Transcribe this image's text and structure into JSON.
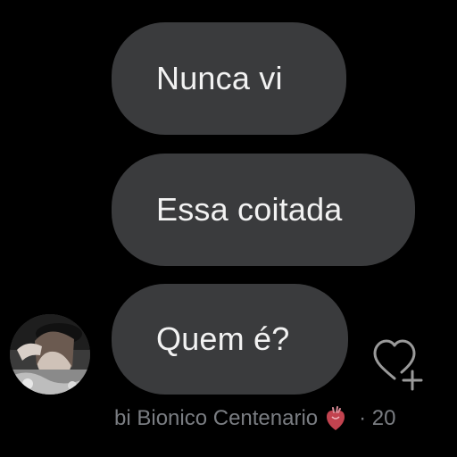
{
  "messages": [
    {
      "text": "Nunca vi"
    },
    {
      "text": "Essa coitada"
    },
    {
      "text": "Quem é?"
    }
  ],
  "sender": {
    "name": "bi Bionico Centenario",
    "badge_icon": "anatomical-heart-emoji",
    "time_fragment": "· 20"
  },
  "reaction": {
    "icon": "heart-plus-icon"
  },
  "colors": {
    "background": "#000000",
    "bubble": "#3a3b3d",
    "bubble_text": "#f2f2f2",
    "meta_text": "#7a7d82"
  }
}
